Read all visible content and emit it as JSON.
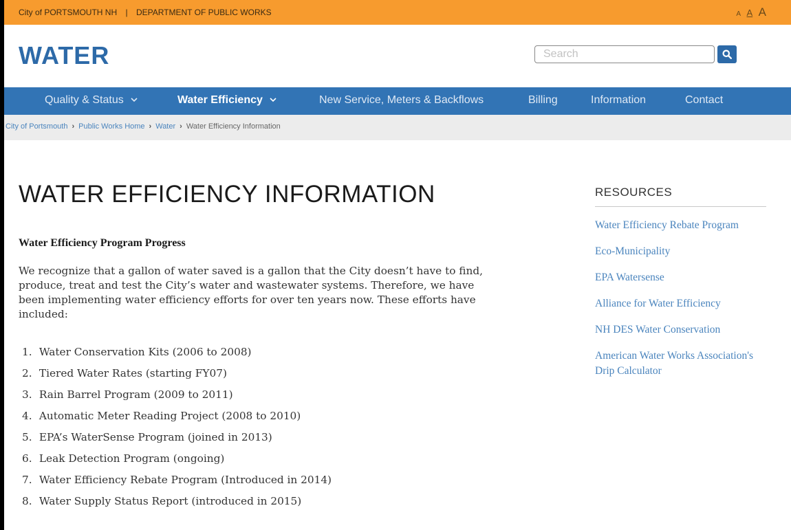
{
  "topbar": {
    "city_link": "City of PORTSMOUTH NH",
    "separator": "|",
    "dept_link": "DEPARTMENT OF PUBLIC WORKS",
    "font_sizes": [
      "A",
      "A",
      "A"
    ]
  },
  "brand": {
    "title": "WATER"
  },
  "search": {
    "placeholder": "Search",
    "value": "",
    "icon": "search-icon"
  },
  "nav": {
    "items": [
      {
        "label": "Quality & Status",
        "dropdown": true
      },
      {
        "label": "Water Efficiency",
        "dropdown": true,
        "active": true
      },
      {
        "label": "New Service, Meters & Backflows"
      },
      {
        "label": "Billing"
      },
      {
        "label": "Information"
      },
      {
        "label": "Contact"
      }
    ]
  },
  "breadcrumb": {
    "items": [
      "City of Portsmouth",
      "Public Works Home",
      "Water",
      "Water Efficiency Information"
    ]
  },
  "main": {
    "title": "WATER EFFICIENCY INFORMATION",
    "subheading": "Water Efficiency Program Progress",
    "intro": "We recognize that a gallon of water saved is a gallon that the City doesn’t have to find, produce, treat and test the City’s water and wastewater systems. Therefore, we have been implementing water efficiency efforts for over ten years now. These efforts have included:",
    "list": [
      {
        "num": "1.",
        "text": "Water Conservation Kits (2006 to 2008)"
      },
      {
        "num": "2.",
        "text": "Tiered Water Rates (starting FY07)"
      },
      {
        "num": "3.",
        "text": "Rain Barrel Program (2009 to 2011)"
      },
      {
        "num": "4.",
        "text": "Automatic Meter Reading Project (2008 to 2010)"
      },
      {
        "num": "5.",
        "text": "EPA’s WaterSense Program (joined in 2013)"
      },
      {
        "num": "6.",
        "text": "Leak Detection Program (ongoing)"
      },
      {
        "num": "7.",
        "text": "Water Efficiency Rebate Program (Introduced in 2014)"
      },
      {
        "num": "8.",
        "text": "Water Supply Status Report (introduced in 2015)"
      }
    ]
  },
  "sidebar": {
    "heading": "RESOURCES",
    "links": [
      "Water Efficiency Rebate Program",
      "Eco-Municipality",
      "EPA Watersense",
      "Alliance for Water Efficiency",
      "NH DES Water Conservation",
      "American Water Works Association's Drip Calculator"
    ]
  },
  "colors": {
    "topbar": "#f79b2e",
    "brand": "#2d6aa8",
    "nav": "#3274b5",
    "link": "#4a84bd",
    "crumbbar": "#ececec"
  }
}
